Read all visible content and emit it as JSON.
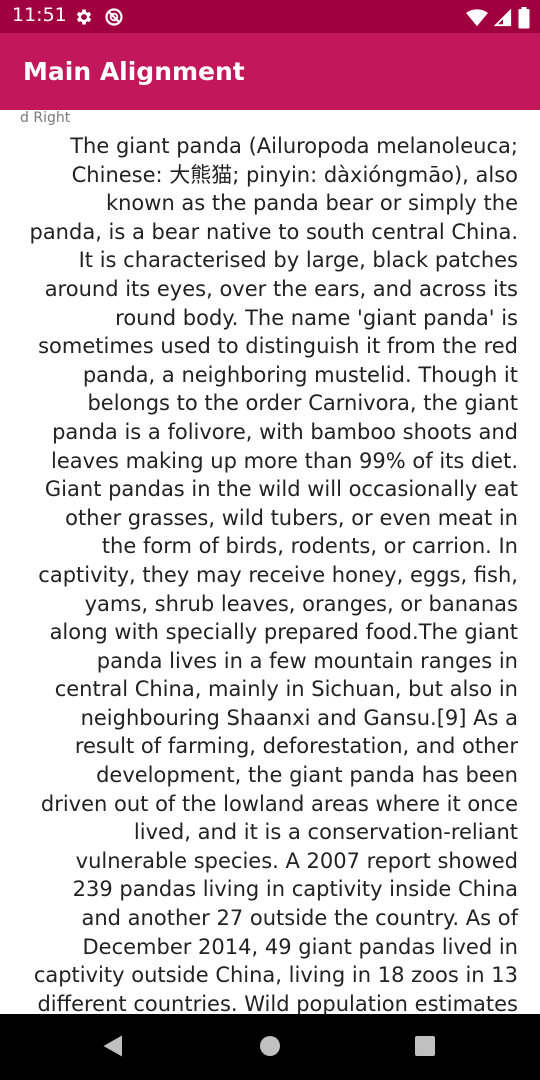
{
  "status_bar": {
    "time": "11:51",
    "icons_left": [
      "settings-icon",
      "do-not-disturb-icon"
    ],
    "icons_right": [
      "wifi-icon",
      "cellular-signal-icon",
      "battery-icon"
    ],
    "background_color": "#a10040"
  },
  "app_bar": {
    "title": "Main Alignment",
    "background_color": "#c2185b"
  },
  "content": {
    "label": "d Right",
    "paragraph": "The giant panda (Ailuropoda melanoleuca;\nChinese: 大熊猫; pinyin: dàxióngmāo), also\nknown as the panda bear or simply the\npanda, is a bear native to south central China.\nIt is characterised by large, black patches\naround its eyes, over the ears, and across its\nround body. The name 'giant panda' is\nsometimes used to distinguish it from the red\npanda, a neighboring mustelid. Though it\nbelongs to the order Carnivora, the giant\npanda is a folivore, with bamboo shoots and\nleaves making up more than 99% of its diet.\nGiant pandas in the wild will occasionally eat\nother grasses, wild tubers, or even meat in\nthe form of birds, rodents, or carrion. In\ncaptivity, they may receive honey, eggs, fish,\nyams, shrub leaves, oranges, or bananas\nalong with specially prepared food.The giant\npanda lives in a few mountain ranges in\ncentral China, mainly in Sichuan, but also in\nneighbouring Shaanxi and Gansu.[9] As a\nresult of farming, deforestation, and other\ndevelopment, the giant panda has been\ndriven out of the lowland areas where it once\nlived, and it is a conservation-reliant\nvulnerable species. A 2007 report showed\n239 pandas living in captivity inside China\nand another 27 outside the country. As of\nDecember 2014, 49 giant pandas lived in\ncaptivity outside China, living in 18 zoos in 13\ndifferent countries. Wild population estimates"
  },
  "nav_bar": {
    "buttons": [
      "back-icon",
      "home-icon",
      "recents-icon"
    ]
  }
}
